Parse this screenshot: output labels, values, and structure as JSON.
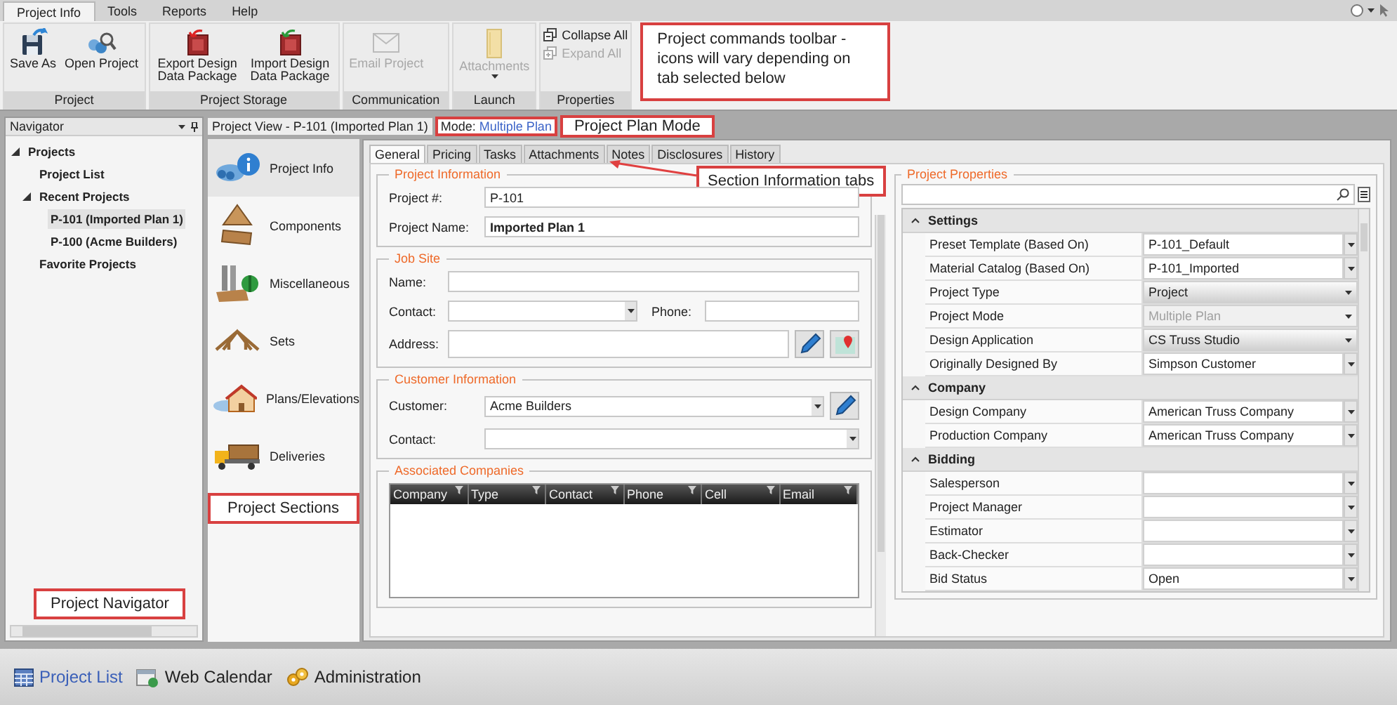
{
  "menu_tabs": [
    {
      "label": "Project Info",
      "selected": true
    },
    {
      "label": "Tools",
      "selected": false
    },
    {
      "label": "Reports",
      "selected": false
    },
    {
      "label": "Help",
      "selected": false
    }
  ],
  "ribbon": {
    "groups": [
      {
        "title": "Project",
        "commands": [
          {
            "label": "Save As",
            "kind": "large",
            "disabled": false
          },
          {
            "label": "Open Project",
            "kind": "large",
            "disabled": false
          }
        ]
      },
      {
        "title": "Project Storage",
        "commands": [
          {
            "label": "Export Design Data Package",
            "kind": "large",
            "disabled": false
          },
          {
            "label": "Import Design Data Package",
            "kind": "large",
            "disabled": false
          }
        ]
      },
      {
        "title": "Communication",
        "commands": [
          {
            "label": "Email Project",
            "kind": "large",
            "disabled": true
          }
        ]
      },
      {
        "title": "Launch",
        "commands": [
          {
            "label": "Attachments",
            "kind": "dropdown",
            "disabled": true
          }
        ]
      },
      {
        "title": "Properties",
        "commands": [
          {
            "label": "Collapse All",
            "kind": "small",
            "disabled": false
          },
          {
            "label": "Expand All",
            "kind": "small",
            "disabled": true
          }
        ]
      }
    ],
    "callout": "Project commands toolbar - icons will vary depending on tab selected below"
  },
  "navigator": {
    "title": "Navigator",
    "tree": [
      {
        "label": "Projects",
        "expanded": true,
        "selected": false,
        "children": [
          {
            "label": "Project List",
            "selected": false
          },
          {
            "label": "Recent Projects",
            "expanded": true,
            "selected": false,
            "children": [
              {
                "label": "P-101 (Imported Plan 1)",
                "selected": true
              },
              {
                "label": "P-100 (Acme Builders)",
                "selected": false
              }
            ]
          },
          {
            "label": "Favorite Projects",
            "selected": false
          }
        ]
      }
    ],
    "callout": "Project Navigator"
  },
  "project_view": {
    "title": "Project View - P-101 (Imported Plan 1)",
    "mode_label": "Mode:",
    "mode_value": "Multiple Plan",
    "mode_callout": "Project Plan Mode",
    "sections": [
      {
        "label": "Project Info",
        "selected": true
      },
      {
        "label": "Components",
        "selected": false
      },
      {
        "label": "Miscellaneous",
        "selected": false
      },
      {
        "label": "Sets",
        "selected": false
      },
      {
        "label": "Plans/Elevations",
        "selected": false
      },
      {
        "label": "Deliveries",
        "selected": false
      }
    ],
    "sections_callout": "Project Sections",
    "tabs": [
      {
        "label": "General",
        "selected": true
      },
      {
        "label": "Pricing",
        "selected": false
      },
      {
        "label": "Tasks",
        "selected": false
      },
      {
        "label": "Attachments",
        "selected": false
      },
      {
        "label": "Notes",
        "selected": false
      },
      {
        "label": "Disclosures",
        "selected": false
      },
      {
        "label": "History",
        "selected": false
      }
    ],
    "tabs_callout": "Section Information tabs"
  },
  "project_information": {
    "title": "Project Information",
    "project_number_label": "Project #:",
    "project_number": "P-101",
    "project_name_label": "Project Name:",
    "project_name": "Imported Plan 1"
  },
  "job_site": {
    "title": "Job Site",
    "name_label": "Name:",
    "contact_label": "Contact:",
    "phone_label": "Phone:",
    "address_label": "Address:"
  },
  "customer_information": {
    "title": "Customer Information",
    "customer_label": "Customer:",
    "customer": "Acme Builders",
    "contact_label": "Contact:"
  },
  "associated_companies": {
    "title": "Associated Companies",
    "columns": [
      "Company",
      "Type",
      "Contact",
      "Phone",
      "Cell",
      "Email"
    ]
  },
  "project_properties": {
    "title": "Project Properties",
    "categories": [
      {
        "name": "Settings",
        "expanded": true,
        "rows": [
          {
            "label": "Preset Template (Based On)",
            "value": "P-101_Default",
            "kind": "combo"
          },
          {
            "label": "Material Catalog (Based On)",
            "value": "P-101_Imported",
            "kind": "combo"
          },
          {
            "label": "Project Type",
            "value": "Project",
            "kind": "select"
          },
          {
            "label": "Project Mode",
            "value": "Multiple Plan",
            "kind": "disabled"
          },
          {
            "label": "Design Application",
            "value": "CS Truss Studio",
            "kind": "select"
          },
          {
            "label": "Originally Designed By",
            "value": "Simpson Customer",
            "kind": "combo"
          }
        ]
      },
      {
        "name": "Company",
        "expanded": true,
        "rows": [
          {
            "label": "Design Company",
            "value": "American Truss Company",
            "kind": "combo"
          },
          {
            "label": "Production Company",
            "value": "American Truss Company",
            "kind": "combo"
          }
        ]
      },
      {
        "name": "Bidding",
        "expanded": true,
        "rows": [
          {
            "label": "Salesperson",
            "kind": "combo"
          },
          {
            "label": "Project Manager",
            "kind": "combo"
          },
          {
            "label": "Estimator",
            "kind": "combo"
          },
          {
            "label": "Back-Checker",
            "kind": "combo"
          },
          {
            "label": "Bid Status",
            "value": "Open",
            "kind": "combo"
          }
        ]
      }
    ]
  },
  "bottom_bar": [
    {
      "label": "Project List",
      "selected": true
    },
    {
      "label": "Web Calendar",
      "selected": false
    },
    {
      "label": "Administration",
      "selected": false
    }
  ]
}
